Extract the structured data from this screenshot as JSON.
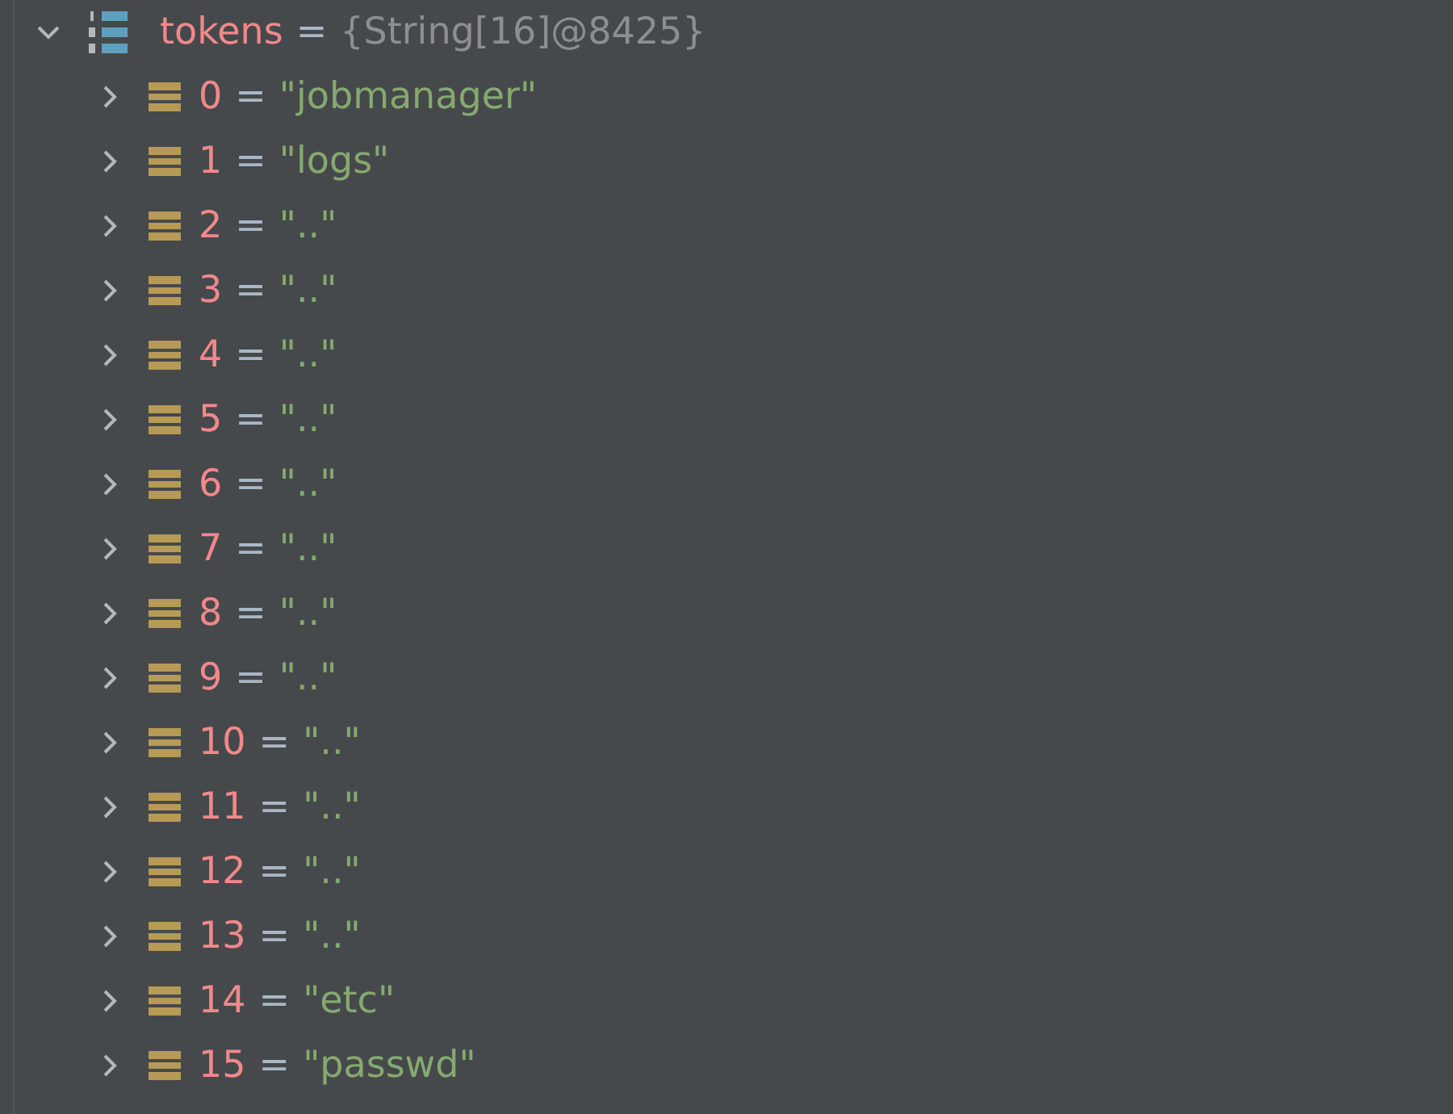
{
  "root": {
    "name": "tokens",
    "separator": "=",
    "value": "{String[16]@8425}",
    "expanded": true,
    "children": [
      {
        "name": "0",
        "separator": "=",
        "value": "\"jobmanager\"",
        "expanded": false
      },
      {
        "name": "1",
        "separator": "=",
        "value": "\"logs\"",
        "expanded": false
      },
      {
        "name": "2",
        "separator": "=",
        "value": "\"..\"",
        "expanded": false
      },
      {
        "name": "3",
        "separator": "=",
        "value": "\"..\"",
        "expanded": false
      },
      {
        "name": "4",
        "separator": "=",
        "value": "\"..\"",
        "expanded": false
      },
      {
        "name": "5",
        "separator": "=",
        "value": "\"..\"",
        "expanded": false
      },
      {
        "name": "6",
        "separator": "=",
        "value": "\"..\"",
        "expanded": false
      },
      {
        "name": "7",
        "separator": "=",
        "value": "\"..\"",
        "expanded": false
      },
      {
        "name": "8",
        "separator": "=",
        "value": "\"..\"",
        "expanded": false
      },
      {
        "name": "9",
        "separator": "=",
        "value": "\"..\"",
        "expanded": false
      },
      {
        "name": "10",
        "separator": "=",
        "value": "\"..\"",
        "expanded": false
      },
      {
        "name": "11",
        "separator": "=",
        "value": "\"..\"",
        "expanded": false
      },
      {
        "name": "12",
        "separator": "=",
        "value": "\"..\"",
        "expanded": false
      },
      {
        "name": "13",
        "separator": "=",
        "value": "\"..\"",
        "expanded": false
      },
      {
        "name": "14",
        "separator": "=",
        "value": "\"etc\"",
        "expanded": false
      },
      {
        "name": "15",
        "separator": "=",
        "value": "\"passwd\"",
        "expanded": false
      }
    ]
  }
}
